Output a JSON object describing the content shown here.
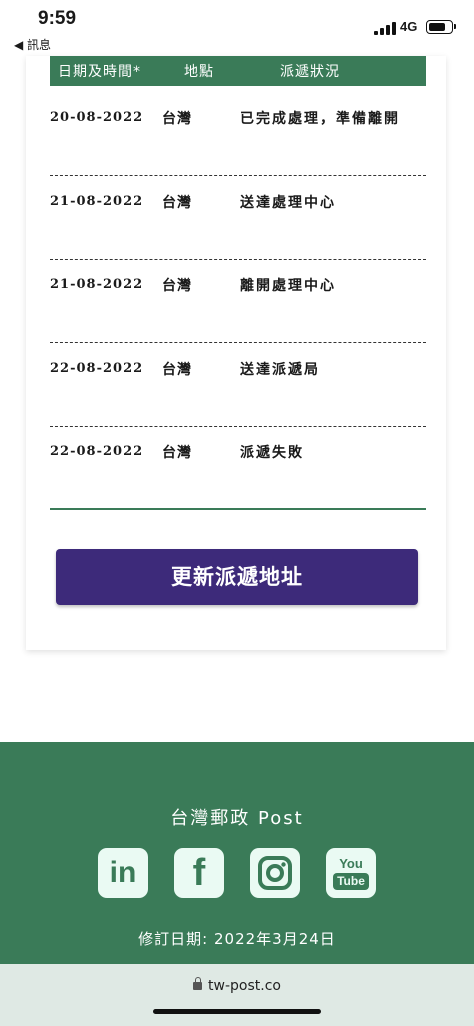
{
  "status_bar": {
    "time": "9:59",
    "back_app": "◀ 訊息",
    "network": "4G",
    "battery_level": 0.8
  },
  "table": {
    "headers": [
      "日期及時間*",
      "地點",
      "派遞狀況"
    ],
    "rows": [
      {
        "date": "20-08-2022",
        "location": "台灣",
        "status": "已完成處理，準備離開"
      },
      {
        "date": "21-08-2022",
        "location": "台灣",
        "status": "送達處理中心"
      },
      {
        "date": "21-08-2022",
        "location": "台灣",
        "status": "離開處理中心"
      },
      {
        "date": "22-08-2022",
        "location": "台灣",
        "status": "送達派遞局"
      },
      {
        "date": "22-08-2022",
        "location": "台灣",
        "status": "派遞失敗"
      }
    ]
  },
  "actions": {
    "update_address": "更新派遞地址"
  },
  "footer": {
    "brand": "台灣郵政 Post",
    "social": [
      {
        "icon": "linkedin-icon",
        "label": "in"
      },
      {
        "icon": "facebook-icon",
        "label": "f"
      },
      {
        "icon": "instagram-icon",
        "label": ""
      },
      {
        "icon": "youtube-icon",
        "label_top": "You",
        "label_bottom": "Tube"
      }
    ],
    "revision": "修訂日期: 2022年3月24日"
  },
  "browser": {
    "url": "tw-post.co"
  },
  "colors": {
    "green": "#3a7b58",
    "purple": "#3d2a7a",
    "mint": "#eafaf3"
  }
}
